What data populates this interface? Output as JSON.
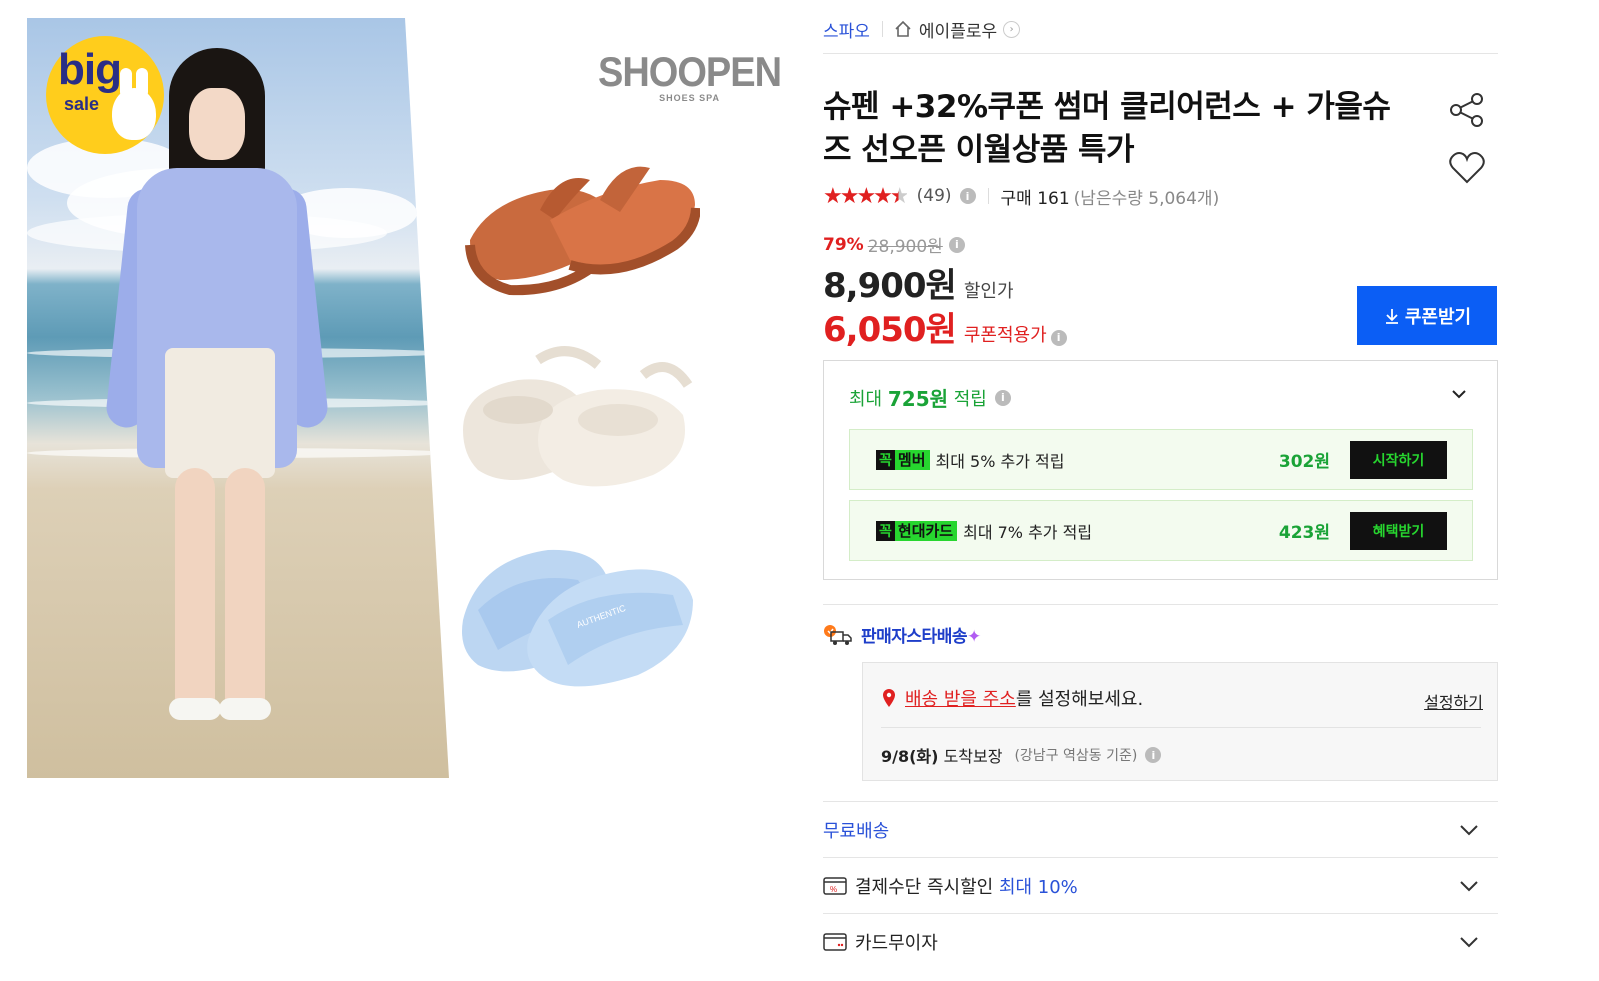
{
  "badge": {
    "big": "big",
    "sale": "sale"
  },
  "brand_logo": {
    "name": "SHOOPEN",
    "sub": "SHOES SPA"
  },
  "breadcrumb": {
    "brand": "스파오",
    "store": "에이플로우"
  },
  "product": {
    "title": "슈펜 +32%쿠폰 썸머 클리어런스 + 가을슈즈 선오픈 이월상품 특가",
    "rating": 4.5,
    "review_count": "(49)",
    "purchase_count": "구매 161",
    "remaining": "(남은수량 5,064개)"
  },
  "price": {
    "discount_rate": "79%",
    "original": "28,900원",
    "sale": "8,900원",
    "sale_label": "할인가",
    "coupon": "6,050원",
    "coupon_label": "쿠폰적용가",
    "coupon_button": "쿠폰받기"
  },
  "points": {
    "prefix": "최대",
    "amount": "725원",
    "suffix": "적립",
    "benefits": [
      {
        "mark": "꼭",
        "tag": "멤버",
        "text": "최대 5% 추가 적립",
        "amount": "302원",
        "button": "시작하기"
      },
      {
        "mark": "꼭",
        "tag": "현대카드",
        "text": "최대 7% 추가 적립",
        "amount": "423원",
        "button": "혜택받기"
      }
    ]
  },
  "shipping": {
    "label": "판매자스타배송",
    "sparkle": "✦",
    "address_link": "배송 받을 주소",
    "address_suffix": "를 설정해보세요.",
    "set_link": "설정하기",
    "arrival_date": "9/8(화)",
    "arrival_label": "도착보장",
    "arrival_note": "(강남구 역삼동 기준)"
  },
  "rows": {
    "free_shipping": "무료배송",
    "payment_discount": "결제수단 즉시할인",
    "payment_discount_max": "최대 10%",
    "card_installment": "카드무이자"
  },
  "colors": {
    "accent_blue": "#0b5ef5",
    "price_red": "#e02020",
    "point_green": "#1aa337",
    "tag_green": "#27d62f"
  },
  "icons": [
    "home-icon",
    "share-icon",
    "heart-icon",
    "info-icon",
    "download-icon",
    "chevron-down-icon",
    "truck-icon",
    "location-pin-icon",
    "payment-icon",
    "card-icon"
  ]
}
